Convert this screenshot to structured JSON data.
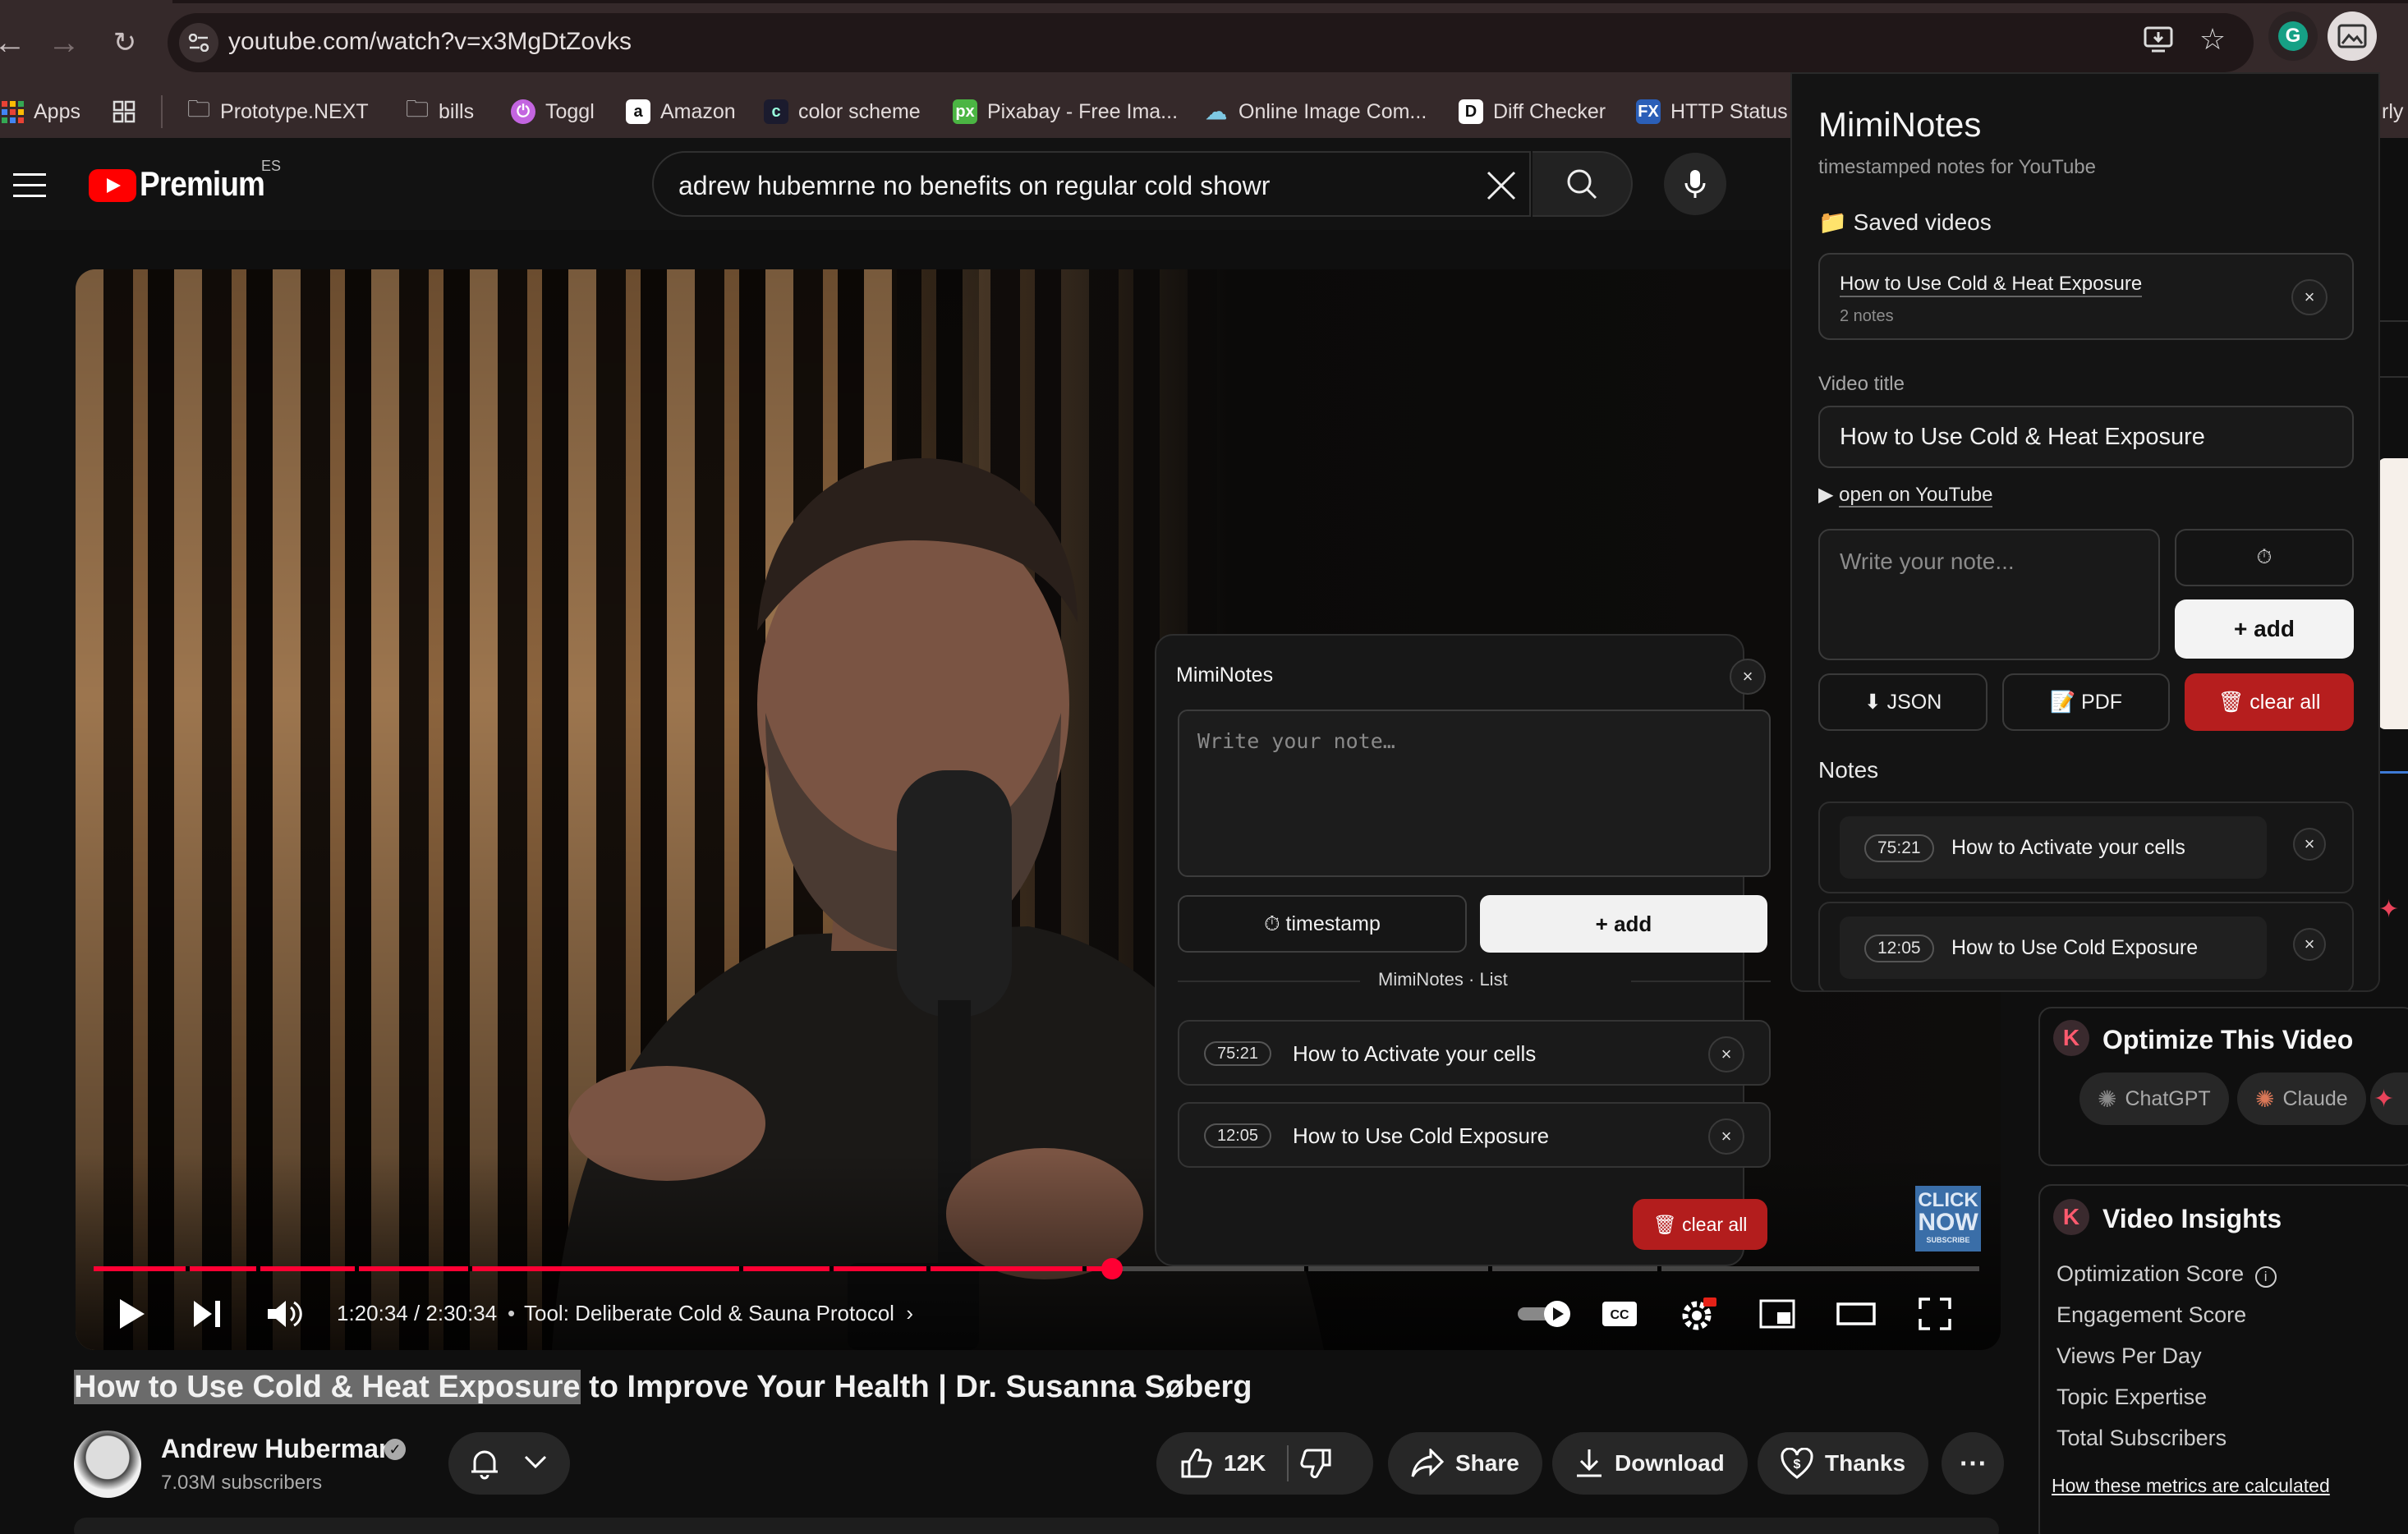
{
  "browser": {
    "url": "youtube.com/watch?v=x3MgDtZovks",
    "bookmarks": [
      {
        "label": "Apps"
      },
      {
        "label": "Prototype.NEXT"
      },
      {
        "label": "bills"
      },
      {
        "label": "Toggl"
      },
      {
        "label": "Amazon"
      },
      {
        "label": "color scheme"
      },
      {
        "label": "Pixabay - Free Ima..."
      },
      {
        "label": "Online Image Com..."
      },
      {
        "label": "Diff Checker"
      },
      {
        "label": "HTTP Status"
      }
    ],
    "bookmarks_trailing_fragment": "rly"
  },
  "youtube": {
    "logo_text": "Premium",
    "region": "ES",
    "search_query": "adrew hubemrne no benefits on regular cold showr",
    "player": {
      "time": "1:20:34 / 2:30:34",
      "chapter": "Tool: Deliberate Cold & Sauna Protocol",
      "progress_fraction": 0.54,
      "click_now_lines": [
        "CLICK",
        "NOW"
      ],
      "click_now_sub": "SUBSCRIBE"
    },
    "video_title_highlight": "How to Use Cold & Heat Exposure",
    "video_title_rest": " to Improve Your Health | Dr. Susanna Søberg",
    "channel": {
      "name": "Andrew Huberman",
      "subscribers": "7.03M subscribers"
    },
    "actions": {
      "likes": "12K",
      "share": "Share",
      "download": "Download",
      "thanks": "Thanks"
    }
  },
  "overlay": {
    "title": "MimiNotes",
    "placeholder": "Write your note…",
    "timestamp_label": "⏱ timestamp",
    "add_label": "+ add",
    "list_label": "MimiNotes · List",
    "notes": [
      {
        "ts": "75:21",
        "text": "How to Activate your cells"
      },
      {
        "ts": "12:05",
        "text": "How to Use Cold Exposure"
      }
    ],
    "clear_label": "🗑 clear all"
  },
  "popup": {
    "title": "MimiNotes",
    "subtitle": "timestamped notes for YouTube",
    "saved_heading": "📁 Saved videos",
    "saved": [
      {
        "title": "How to Use Cold & Heat Exposure",
        "count": "2 notes"
      }
    ],
    "video_title_label": "Video title",
    "video_title_value": "How to Use Cold & Heat Exposure",
    "open_prefix": "▶",
    "open_label": "open on YouTube",
    "note_placeholder": "Write your note...",
    "timer_label": "⏱",
    "add_label": "+ add",
    "json_label": "⬇ JSON",
    "pdf_label": "📝 PDF",
    "clear_label": "🗑 clear all",
    "notes_heading": "Notes",
    "notes": [
      {
        "ts": "75:21",
        "text": "How to Activate your cells"
      },
      {
        "ts": "12:05",
        "text": "How to Use Cold Exposure"
      }
    ]
  },
  "sidebar": {
    "optimize_title": "Optimize This Video",
    "ai_buttons": [
      "ChatGPT",
      "Claude"
    ],
    "insights_title": "Video Insights",
    "metrics": [
      "Optimization Score",
      "Engagement Score",
      "Views Per Day",
      "Topic Expertise",
      "Total Subscribers"
    ],
    "metrics_link": "How these metrics are calculated"
  },
  "colors": {
    "accent": "#ff0033",
    "danger": "#b61e1e",
    "brand": "#ff0000"
  }
}
